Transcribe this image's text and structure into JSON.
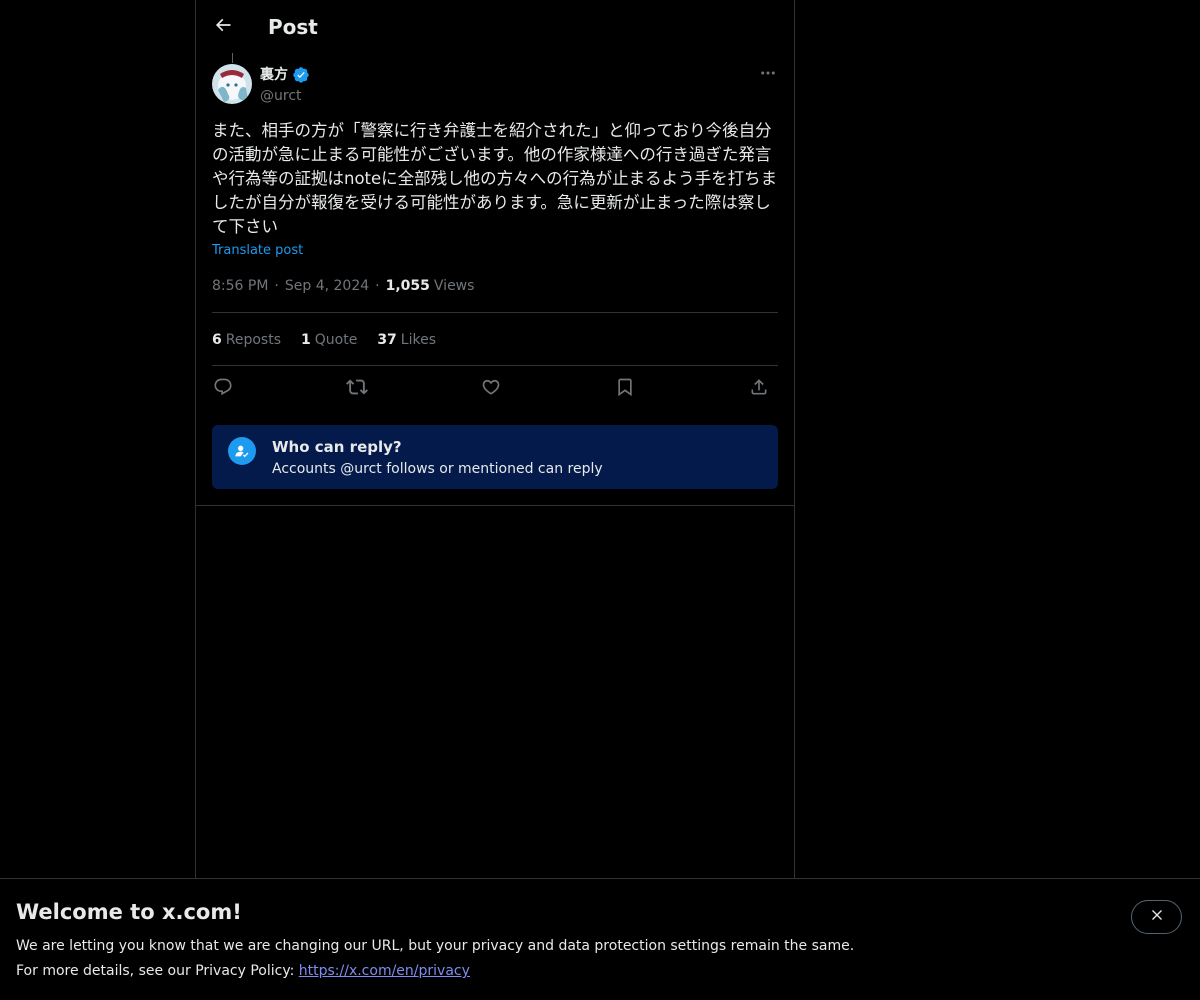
{
  "header": {
    "title": "Post",
    "back_icon": "arrow-left-icon"
  },
  "post": {
    "author_name": "裏方",
    "author_handle": "@urct",
    "verified": true,
    "text": "また、相手の方が「警察に行き弁護士を紹介された」と仰っており今後自分の活動が急に止まる可能性がございます。他の作家様達への行き過ぎた発言や行為等の証拠はnoteに全部残し他の方々への行為が止まるよう手を打ちましたが自分が報復を受ける可能性があります。急に更新が止まった際は察して下さい",
    "translate_label": "Translate post",
    "time": "8:56 PM",
    "date": "Sep 4, 2024",
    "views_count": "1,055",
    "views_label": "Views"
  },
  "stats": {
    "reposts_count": "6",
    "reposts_label": "Reposts",
    "quotes_count": "1",
    "quotes_label": "Quote",
    "likes_count": "37",
    "likes_label": "Likes"
  },
  "actions": [
    "reply-icon",
    "repost-icon",
    "like-icon",
    "bookmark-icon",
    "share-icon"
  ],
  "reply_restriction": {
    "title": "Who can reply?",
    "subtitle": "Accounts @urct follows or mentioned can reply"
  },
  "banner": {
    "title": "Welcome to x.com!",
    "line1": "We are letting you know that we are changing our URL, but your privacy and data protection settings remain the same.",
    "line2_prefix": "For more details, see our Privacy Policy: ",
    "link": "https://x.com/en/privacy"
  },
  "colors": {
    "background": "#000000",
    "accent": "#1d9bf0",
    "muted": "#71767b",
    "border": "#2f3336",
    "reply_box": "#031a4a",
    "link": "#7f8cf0"
  }
}
